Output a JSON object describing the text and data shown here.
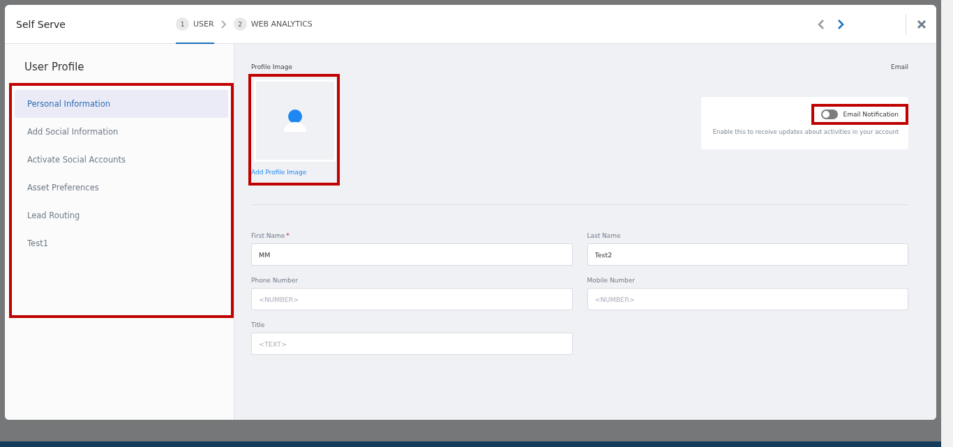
{
  "window": {
    "title": "Self Serve"
  },
  "steps": [
    {
      "number": "1",
      "label": "USER",
      "selected": true
    },
    {
      "number": "2",
      "label": "WEB ANALYTICS",
      "selected": false
    }
  ],
  "nav": {
    "prev_disabled": true,
    "next_disabled": false
  },
  "sidebar": {
    "title": "User Profile",
    "highlighted": true,
    "items": [
      {
        "label": "Personal Information",
        "selected": true
      },
      {
        "label": "Add Social Information",
        "selected": false
      },
      {
        "label": "Activate Social Accounts",
        "selected": false
      },
      {
        "label": "Asset Preferences",
        "selected": false
      },
      {
        "label": "Lead Routing",
        "selected": false
      },
      {
        "label": "Test1",
        "selected": false
      }
    ]
  },
  "profile_image": {
    "label": "Profile Image",
    "link": "Add Profile Image",
    "highlighted": true
  },
  "email": {
    "label": "Email"
  },
  "notification": {
    "label": "Email Notification",
    "on": false,
    "highlighted": true,
    "description": "Enable this to receive updates about activities in your account"
  },
  "fields": [
    {
      "label": "First Name",
      "marker": "*",
      "value": "MM"
    },
    {
      "label": "Last Name",
      "value": "Test2"
    },
    {
      "label": "Phone Number",
      "placeholder": "<NUMBER>"
    },
    {
      "label": "Mobile Number",
      "placeholder": "<NUMBER>"
    },
    {
      "label": "Title",
      "placeholder": "<TEXT>"
    }
  ]
}
